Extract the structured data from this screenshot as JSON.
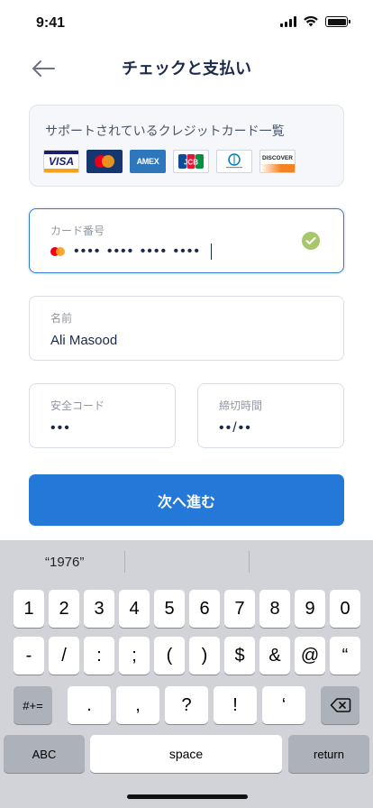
{
  "status_bar": {
    "time": "9:41"
  },
  "header": {
    "title": "チェックと支払い",
    "back_icon": "arrow-left-icon"
  },
  "supported_cards": {
    "title": "サポートされているクレジットカード一覧",
    "logos": [
      {
        "name": "visa",
        "label": "VISA"
      },
      {
        "name": "mastercard",
        "label": ""
      },
      {
        "name": "amex",
        "label": "AMEX"
      },
      {
        "name": "jcb",
        "label": "JCB"
      },
      {
        "name": "diners-club",
        "label": ""
      },
      {
        "name": "discover",
        "label": "DISCOVER"
      }
    ]
  },
  "form": {
    "card_number": {
      "label": "カード番号",
      "value": "•••• •••• •••• ••••",
      "valid": true
    },
    "name": {
      "label": "名前",
      "value": "Ali Masood"
    },
    "security_code": {
      "label": "安全コード",
      "value": "•••"
    },
    "expiry": {
      "label": "締切時間",
      "value": "••/••"
    }
  },
  "next_button": {
    "label": "次へ進む"
  },
  "keyboard": {
    "suggestions": [
      "“1976”",
      "",
      ""
    ],
    "row1": [
      "1",
      "2",
      "3",
      "4",
      "5",
      "6",
      "7",
      "8",
      "9",
      "0"
    ],
    "row2": [
      "-",
      "/",
      ":",
      ";",
      "(",
      ")",
      "$",
      "&",
      "@",
      "“"
    ],
    "row3_left": "#+=",
    "row3": [
      ".",
      ",",
      "?",
      "!",
      "‘"
    ],
    "row3_right_icon": "backspace-icon",
    "abc_label": "ABC",
    "space_label": "space",
    "return_label": "return"
  },
  "colors": {
    "primary": "#2479d8",
    "text_dark": "#1b2a4a",
    "valid_check": "#a7c76a",
    "keyboard_bg": "#d1d3d9"
  }
}
